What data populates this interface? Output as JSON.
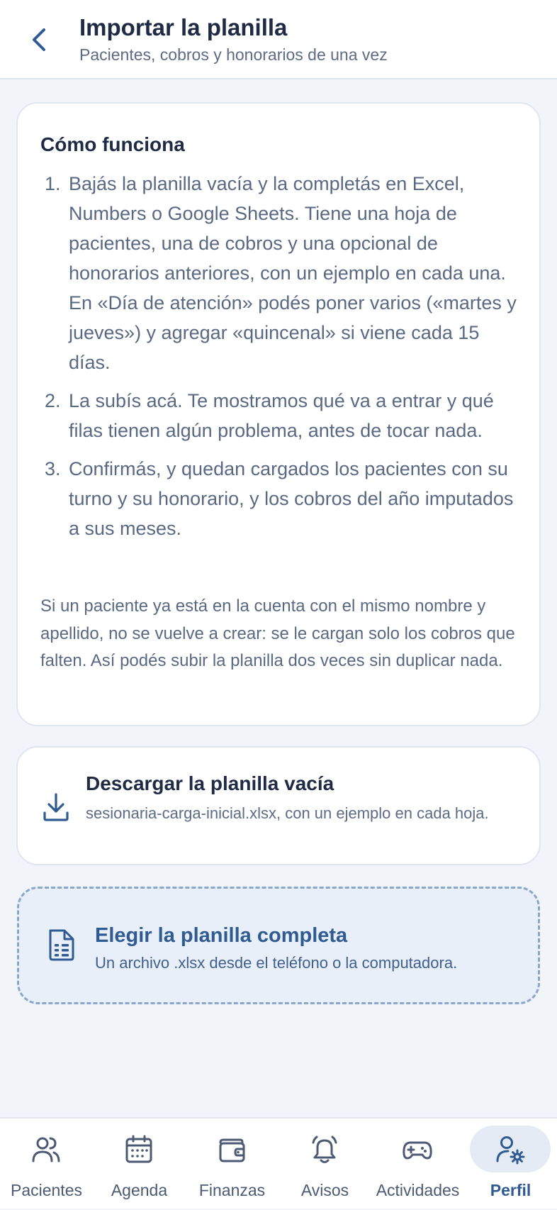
{
  "header": {
    "title": "Importar la planilla",
    "subtitle": "Pacientes, cobros y honorarios de una vez"
  },
  "how": {
    "title": "Cómo funciona",
    "steps": [
      {
        "num": "1.",
        "text": "Bajás la planilla vacía y la completás en Excel, Numbers o Google Sheets. Tiene una hoja de pacientes, una de cobros y una opcional de honorarios anteriores, con un ejemplo en cada una. En «Día de atención» podés poner varios («martes y jueves») y agregar «quincenal» si viene cada 15 días."
      },
      {
        "num": "2.",
        "text": "La subís acá. Te mostramos qué va a entrar y qué filas tienen algún problema, antes de tocar nada."
      },
      {
        "num": "3.",
        "text": "Confirmás, y quedan cargados los pacientes con su turno y su honorario, y los cobros del año imputados a sus meses."
      }
    ],
    "note": "Si un paciente ya está en la cuenta con el mismo nombre y apellido, no se vuelve a crear: se le cargan solo los cobros que falten. Así podés subir la planilla dos veces sin duplicar nada."
  },
  "download": {
    "title": "Descargar la planilla vacía",
    "subtitle": "sesionaria-carga-inicial.xlsx, con un ejemplo en cada hoja.",
    "icon": "download-icon"
  },
  "upload": {
    "title": "Elegir la planilla completa",
    "subtitle": "Un archivo .xlsx desde el teléfono o la computadora.",
    "icon": "spreadsheet-file-icon"
  },
  "tabs": [
    {
      "label": "Pacientes",
      "icon": "users-icon"
    },
    {
      "label": "Agenda",
      "icon": "calendar-icon"
    },
    {
      "label": "Finanzas",
      "icon": "wallet-icon"
    },
    {
      "label": "Avisos",
      "icon": "bell-icon"
    },
    {
      "label": "Actividades",
      "icon": "gamepad-icon"
    },
    {
      "label": "Perfil",
      "icon": "user-settings-icon",
      "active": true
    }
  ],
  "colors": {
    "accent": "#2f5a92",
    "background": "#f1f4f9",
    "upload_bg": "#e8eff9"
  }
}
